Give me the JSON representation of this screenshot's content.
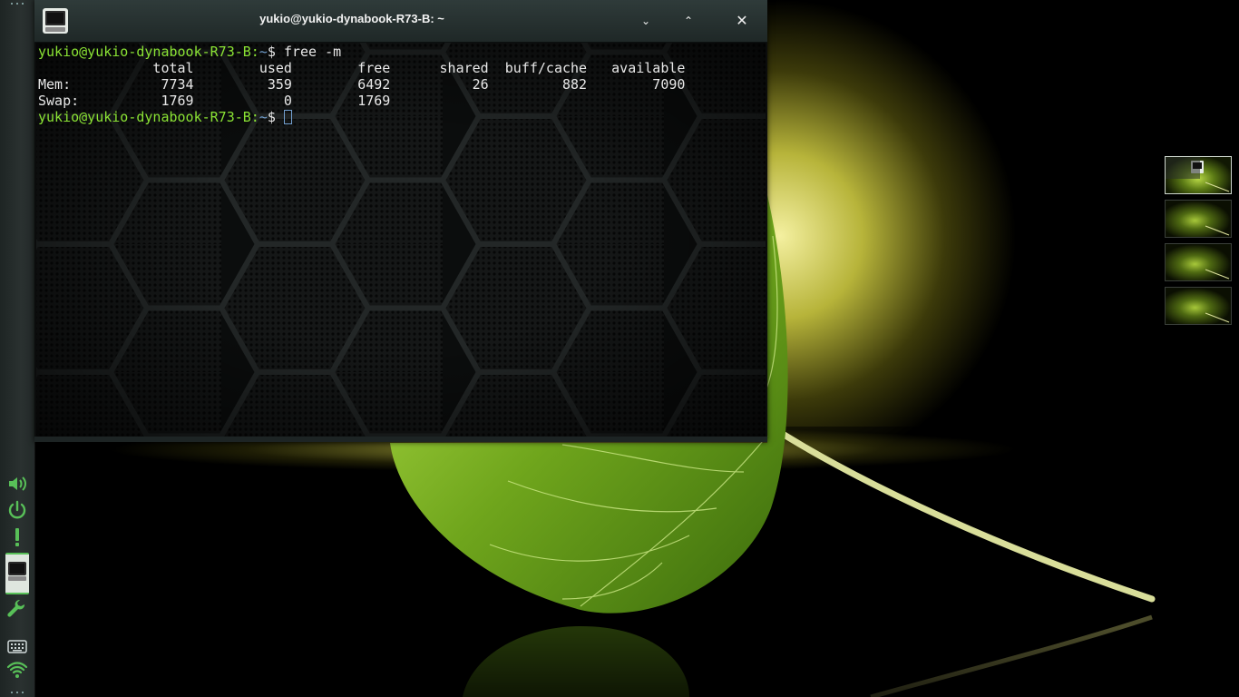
{
  "window": {
    "title": "yukio@yukio-dynabook-R73-B: ~",
    "buttons": {
      "minimize": "⌄",
      "maximize": "⌃",
      "close": "✕"
    }
  },
  "terminal": {
    "prompt_user": "yukio@yukio-dynabook-R73-B:",
    "prompt_path": "~",
    "prompt_symbol": "$ ",
    "command": "free -m",
    "header": "              total        used        free      shared  buff/cache   available",
    "rows": [
      "Mem:           7734         359        6492          26         882        7090",
      "Swap:          1769           0        1769"
    ]
  },
  "panel": {
    "icons": [
      "volume-icon",
      "power-icon",
      "alert-icon",
      "terminal-task-icon",
      "wrench-icon",
      "keyboard-icon",
      "wifi-icon"
    ]
  },
  "pager": {
    "workspaces": 4,
    "active": 1
  },
  "colors": {
    "accent_green": "#58c058",
    "prompt_green": "#8ae234",
    "prompt_blue": "#729fcf",
    "titlebar": "#2a3534"
  }
}
